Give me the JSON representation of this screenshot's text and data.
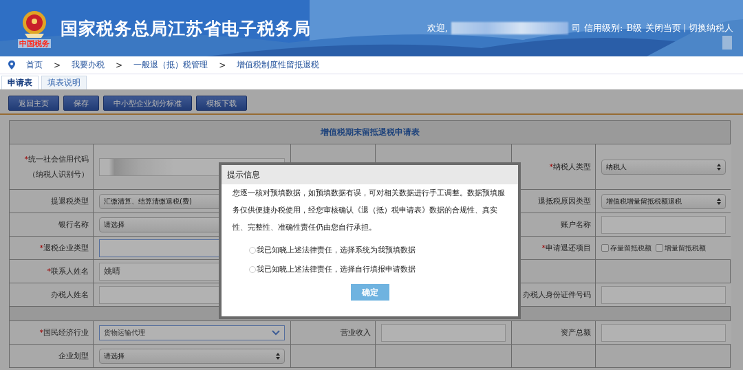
{
  "header": {
    "logo_caption": "中国税务",
    "title": "国家税务总局江苏省电子税务局",
    "welcome": "欢迎,",
    "name_suffix": "司",
    "credit_label": "信用级别:",
    "credit_level": "B级",
    "links": [
      "关闭当页",
      "切换纳税人"
    ]
  },
  "breadcrumb": [
    "首页",
    "我要办税",
    "一般退（抵）税管理",
    "增值税制度性留抵退税"
  ],
  "separator": ">",
  "tabs": [
    {
      "label": "申请表",
      "selected": true
    },
    {
      "label": "填表说明",
      "selected": false
    }
  ],
  "toolbar": [
    "返回主页",
    "保存",
    "中小型企业划分标准",
    "模板下载"
  ],
  "form": {
    "title": "增值税期末留抵退税申请表",
    "rows": [
      {
        "kind": "row",
        "tall": true,
        "cells": [
          {
            "label": "统一社会信用代码（纳税人识别号）",
            "mark": "*",
            "field": {
              "kind": "redacted"
            }
          },
          null,
          {
            "label": "纳税人类型",
            "mark": "*",
            "field": {
              "kind": "select",
              "value": "纳税人"
            }
          }
        ]
      },
      {
        "kind": "row",
        "cells": [
          {
            "label": "提退税类型",
            "field": {
              "kind": "select",
              "value": "汇缴清算、结算清缴退税(费)"
            }
          },
          null,
          {
            "label": "退抵税原因类型",
            "field": {
              "kind": "select",
              "value": "增值税增量留抵税额退税"
            }
          }
        ]
      },
      {
        "kind": "row",
        "cells": [
          {
            "label": "银行名称",
            "field": {
              "kind": "select",
              "value": "请选择"
            }
          },
          null,
          {
            "label": "账户名称",
            "field": {
              "kind": "text"
            }
          }
        ]
      },
      {
        "kind": "row",
        "cells": [
          {
            "label": "退税企业类型",
            "mark": "*",
            "field": {
              "kind": "text",
              "focused": true
            }
          },
          null,
          {
            "label": "申请退还项目",
            "mark": "*",
            "field": {
              "kind": "checks",
              "options": [
                {
                  "label": "存量留抵税额",
                  "checked": false
                },
                {
                  "label": "增量留抵税额",
                  "checked": false
                }
              ]
            }
          }
        ]
      },
      {
        "kind": "row",
        "cells": [
          {
            "label": "联系人姓名",
            "mark": "*",
            "field": {
              "kind": "text",
              "value": "姚晴"
            }
          },
          null,
          null
        ]
      },
      {
        "kind": "row",
        "cells": [
          {
            "label": "办税人姓名",
            "field": {
              "kind": "text"
            }
          },
          null,
          {
            "label": "办税人身份证件号码",
            "field": {
              "kind": "text"
            }
          }
        ]
      },
      {
        "kind": "gap"
      },
      {
        "kind": "row",
        "cells": [
          {
            "label": "国民经济行业",
            "mark": "*",
            "field": {
              "kind": "combo",
              "value": "货物运输代理"
            }
          },
          {
            "label": "营业收入",
            "field": {
              "kind": "text"
            }
          },
          {
            "label": "资产总额",
            "field": {
              "kind": "text"
            }
          }
        ]
      },
      {
        "kind": "row",
        "cells": [
          {
            "label": "企业划型",
            "field": {
              "kind": "select",
              "value": "请选择"
            }
          },
          null,
          null
        ]
      }
    ]
  },
  "dialog": {
    "title": "提示信息",
    "message": "您逐一核对预填数据，如预填数据有误，可对相关数据进行手工调整。数据预填服务仅供便捷办税使用，经您审核确认《退（抵）税申请表》数据的合规性、真实性、完整性、准确性责任仍由您自行承担。",
    "options": [
      {
        "label": "我已知晓上述法律责任，选择系统为我预填数据",
        "selected": false
      },
      {
        "label": "我已知晓上述法律责任，选择自行填报申请数据",
        "selected": false
      }
    ],
    "confirm": "确定"
  }
}
